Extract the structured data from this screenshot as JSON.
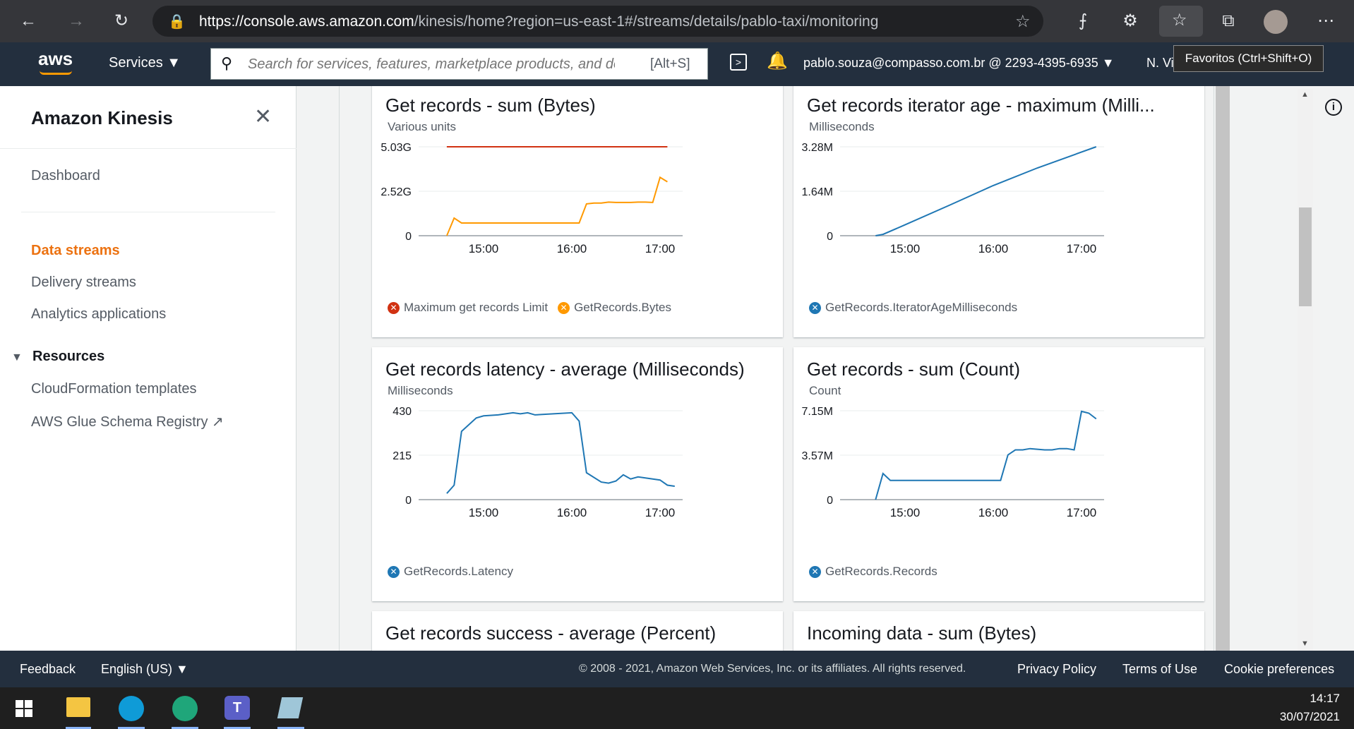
{
  "browser": {
    "url_host": "https://console.aws.amazon.com",
    "url_path": "/kinesis/home?region=us-east-1#/streams/details/pablo-taxi/monitoring",
    "tooltip": "Favoritos (Ctrl+Shift+O)"
  },
  "aws_nav": {
    "logo": "aws",
    "services": "Services",
    "search_placeholder": "Search for services, features, marketplace products, and docs",
    "search_shortcut": "[Alt+S]",
    "account": "pablo.souza@compasso.com.br @ 2293-4395-6935",
    "region": "N. Vi"
  },
  "sidebar": {
    "title": "Amazon Kinesis",
    "dashboard": "Dashboard",
    "items": [
      "Data streams",
      "Delivery streams",
      "Analytics applications"
    ],
    "resources_header": "Resources",
    "resources": [
      "CloudFormation templates",
      "AWS Glue Schema Registry"
    ]
  },
  "charts": [
    {
      "title": "Get records - sum (Bytes)",
      "units": "Various units",
      "ticks": [
        "5.03G",
        "2.52G",
        "0"
      ],
      "xticks": [
        "15:00",
        "16:00",
        "17:00"
      ],
      "legend": [
        "Maximum get records Limit",
        "GetRecords.Bytes"
      ]
    },
    {
      "title": "Get records iterator age - maximum (Milli...",
      "units": "Milliseconds",
      "ticks": [
        "3.28M",
        "1.64M",
        "0"
      ],
      "xticks": [
        "15:00",
        "16:00",
        "17:00"
      ],
      "legend": [
        "GetRecords.IteratorAgeMilliseconds"
      ]
    },
    {
      "title": "Get records latency - average (Milliseconds)",
      "units": "Milliseconds",
      "ticks": [
        "430",
        "215",
        "0"
      ],
      "xticks": [
        "15:00",
        "16:00",
        "17:00"
      ],
      "legend": [
        "GetRecords.Latency"
      ]
    },
    {
      "title": "Get records - sum (Count)",
      "units": "Count",
      "ticks": [
        "7.15M",
        "3.57M",
        "0"
      ],
      "xticks": [
        "15:00",
        "16:00",
        "17:00"
      ],
      "legend": [
        "GetRecords.Records"
      ]
    },
    {
      "title": "Get records success - average (Percent)"
    },
    {
      "title": "Incoming data - sum (Bytes)"
    }
  ],
  "chart_data": [
    {
      "type": "line",
      "title": "Get records - sum (Bytes)",
      "ylabel": "Various units",
      "ylim": [
        0,
        5.03
      ],
      "yunit": "G",
      "xlabel_ticks": [
        "15:00",
        "16:00",
        "17:00"
      ],
      "series": [
        {
          "name": "Maximum get records Limit",
          "color": "#d13212",
          "x": [
            "14:35",
            "17:05"
          ],
          "values": [
            5.03,
            5.03
          ]
        },
        {
          "name": "GetRecords.Bytes",
          "color": "#ff9900",
          "x": [
            "14:35",
            "14:40",
            "14:45",
            "14:50",
            "15:00",
            "15:30",
            "16:05",
            "16:10",
            "16:15",
            "16:20",
            "16:25",
            "16:30",
            "16:35",
            "16:40",
            "16:45",
            "16:50",
            "16:55",
            "17:00",
            "17:05"
          ],
          "values": [
            0,
            1.0,
            0.72,
            0.72,
            0.72,
            0.72,
            0.72,
            1.8,
            1.85,
            1.85,
            1.9,
            1.88,
            1.88,
            1.88,
            1.9,
            1.9,
            1.88,
            3.3,
            3.05
          ]
        }
      ]
    },
    {
      "type": "line",
      "title": "Get records iterator age - maximum (Milli...",
      "ylabel": "Milliseconds",
      "ylim": [
        0,
        3.28
      ],
      "yunit": "M",
      "xlabel_ticks": [
        "15:00",
        "16:00",
        "17:00"
      ],
      "series": [
        {
          "name": "GetRecords.IteratorAgeMilliseconds",
          "color": "#1f77b4",
          "x": [
            "14:40",
            "14:45",
            "15:00",
            "15:30",
            "16:00",
            "16:30",
            "17:10"
          ],
          "values": [
            0,
            0.05,
            0.4,
            1.12,
            1.85,
            2.5,
            3.28
          ]
        }
      ]
    },
    {
      "type": "line",
      "title": "Get records latency - average (Milliseconds)",
      "ylabel": "Milliseconds",
      "ylim": [
        0,
        430
      ],
      "xlabel_ticks": [
        "15:00",
        "16:00",
        "17:00"
      ],
      "series": [
        {
          "name": "GetRecords.Latency",
          "color": "#1f77b4",
          "x": [
            "14:35",
            "14:40",
            "14:45",
            "14:55",
            "15:00",
            "15:10",
            "15:20",
            "15:25",
            "15:30",
            "15:35",
            "15:40",
            "16:00",
            "16:05",
            "16:10",
            "16:20",
            "16:25",
            "16:30",
            "16:35",
            "16:40",
            "16:45",
            "16:50",
            "17:00",
            "17:05",
            "17:10"
          ],
          "values": [
            30,
            70,
            330,
            395,
            405,
            410,
            420,
            415,
            420,
            410,
            412,
            420,
            380,
            130,
            85,
            80,
            90,
            120,
            100,
            110,
            105,
            95,
            70,
            65
          ]
        }
      ]
    },
    {
      "type": "line",
      "title": "Get records - sum (Count)",
      "ylabel": "Count",
      "ylim": [
        0,
        7.15
      ],
      "yunit": "M",
      "xlabel_ticks": [
        "15:00",
        "16:00",
        "17:00"
      ],
      "series": [
        {
          "name": "GetRecords.Records",
          "color": "#1f77b4",
          "x": [
            "14:40",
            "14:45",
            "14:50",
            "15:00",
            "15:30",
            "16:00",
            "16:05",
            "16:10",
            "16:15",
            "16:20",
            "16:25",
            "16:30",
            "16:35",
            "16:40",
            "16:45",
            "16:50",
            "16:55",
            "17:00",
            "17:05",
            "17:10"
          ],
          "values": [
            0,
            2.1,
            1.55,
            1.55,
            1.55,
            1.55,
            1.55,
            3.6,
            4.0,
            4.0,
            4.1,
            4.05,
            4.0,
            4.0,
            4.1,
            4.1,
            4.0,
            7.1,
            6.95,
            6.5
          ]
        }
      ]
    }
  ],
  "footer": {
    "feedback": "Feedback",
    "language": "English (US)",
    "copyright": "© 2008 - 2021, Amazon Web Services, Inc. or its affiliates. All rights reserved.",
    "privacy": "Privacy Policy",
    "terms": "Terms of Use",
    "cookies": "Cookie preferences"
  },
  "taskbar": {
    "time": "14:17",
    "date": "30/07/2021"
  },
  "colors": {
    "accent": "#ec7211",
    "nav_bg": "#232f3e",
    "line_blue": "#1f77b4",
    "line_orange": "#ff9900",
    "limit_red": "#d13212"
  }
}
